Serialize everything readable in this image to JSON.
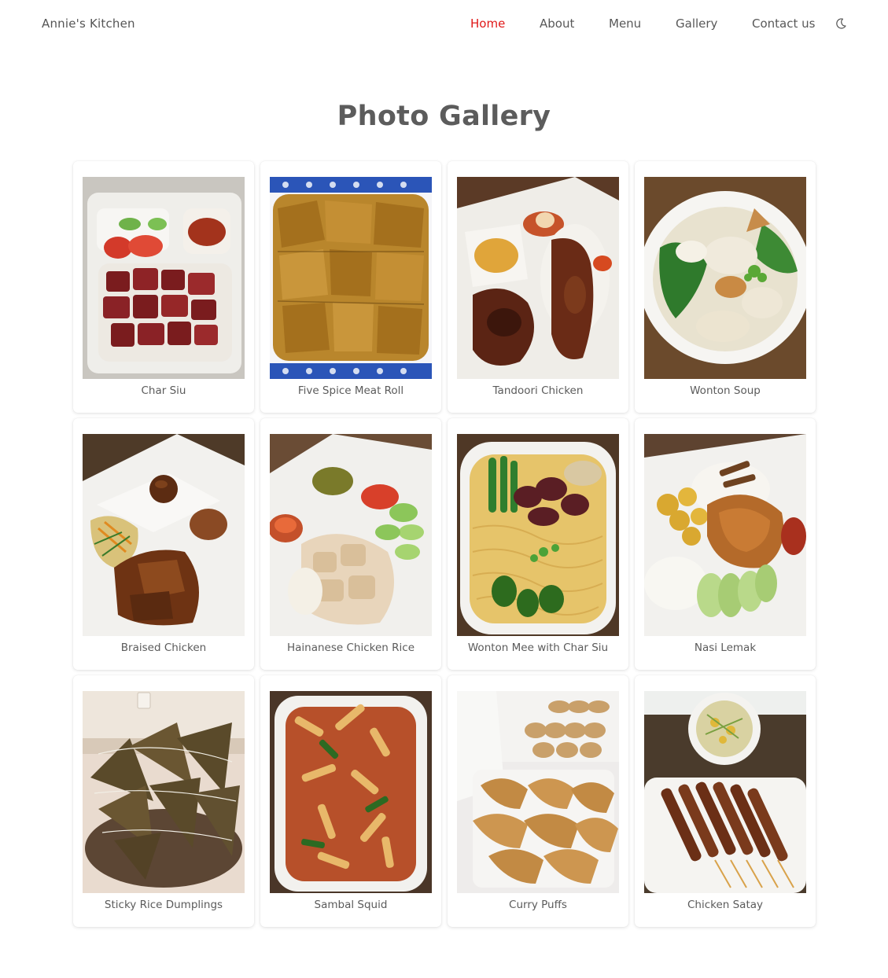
{
  "site": {
    "brand": "Annie's Kitchen"
  },
  "nav": {
    "items": [
      {
        "label": "Home",
        "active": true
      },
      {
        "label": "About",
        "active": false
      },
      {
        "label": "Menu",
        "active": false
      },
      {
        "label": "Gallery",
        "active": false
      },
      {
        "label": "Contact us",
        "active": false
      }
    ],
    "theme_icon": "moon-icon"
  },
  "colors": {
    "accent": "#e01818",
    "text": "#5f5f5f"
  },
  "gallery": {
    "title": "Photo Gallery",
    "items": [
      {
        "caption": "Char Siu",
        "icon": "char-siu-photo"
      },
      {
        "caption": "Five Spice Meat Roll",
        "icon": "five-spice-meat-roll-photo"
      },
      {
        "caption": "Tandoori Chicken",
        "icon": "tandoori-chicken-photo"
      },
      {
        "caption": "Wonton Soup",
        "icon": "wonton-soup-photo"
      },
      {
        "caption": "Braised Chicken",
        "icon": "braised-chicken-photo"
      },
      {
        "caption": "Hainanese Chicken Rice",
        "icon": "hainanese-chicken-rice-photo"
      },
      {
        "caption": "Wonton Mee with Char Siu",
        "icon": "wonton-mee-photo"
      },
      {
        "caption": "Nasi Lemak",
        "icon": "nasi-lemak-photo"
      },
      {
        "caption": "Sticky Rice Dumplings",
        "icon": "sticky-rice-dumplings-photo"
      },
      {
        "caption": "Sambal Squid",
        "icon": "sambal-squid-photo"
      },
      {
        "caption": "Curry Puffs",
        "icon": "curry-puffs-photo"
      },
      {
        "caption": "Chicken Satay",
        "icon": "chicken-satay-photo"
      }
    ]
  }
}
